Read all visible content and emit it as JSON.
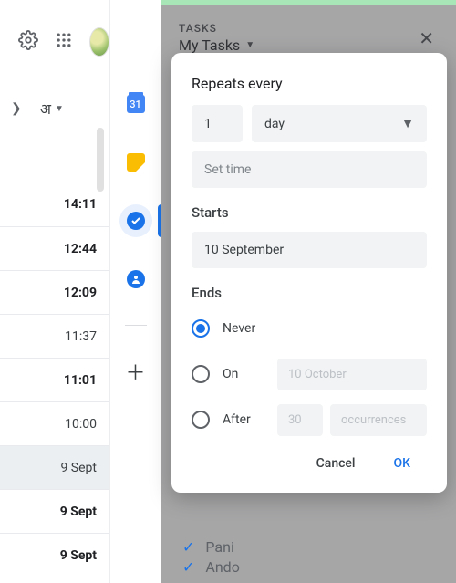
{
  "topbar": {
    "script_label": "अ"
  },
  "sidebar": {
    "calendar_day": "31"
  },
  "times": [
    {
      "label": "14:11",
      "bold": true,
      "sel": false
    },
    {
      "label": "12:44",
      "bold": true,
      "sel": false
    },
    {
      "label": "12:09",
      "bold": true,
      "sel": false
    },
    {
      "label": "11:37",
      "bold": false,
      "sel": false
    },
    {
      "label": "11:01",
      "bold": true,
      "sel": false
    },
    {
      "label": "10:00",
      "bold": false,
      "sel": false
    },
    {
      "label": "9 Sept",
      "bold": false,
      "sel": true
    },
    {
      "label": "9 Sept",
      "bold": true,
      "sel": false
    },
    {
      "label": "9 Sept",
      "bold": true,
      "sel": false
    }
  ],
  "tasks_panel": {
    "label": "TASKS",
    "title": "My Tasks",
    "completed_task": "Pani",
    "completed_task2": "Ando"
  },
  "dialog": {
    "repeats_every": "Repeats every",
    "interval": "1",
    "unit": "day",
    "set_time": "Set time",
    "starts_label": "Starts",
    "starts_date": "10 September",
    "ends_label": "Ends",
    "never": "Never",
    "on": "On",
    "on_date": "10 October",
    "after": "After",
    "after_count": "30",
    "occurrences": "occurrences",
    "cancel": "Cancel",
    "ok": "OK"
  }
}
